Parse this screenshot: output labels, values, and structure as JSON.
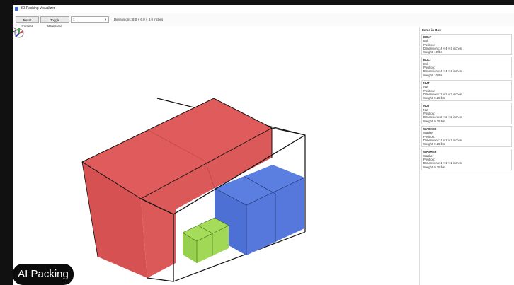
{
  "window": {
    "title": "3D Packing Visualizer"
  },
  "toolbar": {
    "reset_camera_label": "Reset Camera",
    "toggle_wireframe_label": "Toggle Wireframe",
    "combo_value": "1",
    "dimensions_text": "Dimensions: 8.0 × 6.0 × 4.0 inches"
  },
  "panel": {
    "header": "Items in Box",
    "items": [
      {
        "name": "BOLT",
        "type": "Bolt",
        "position": "Position:",
        "dimensions": "Dimensions: 4 × 4 × 4 inches",
        "weight": "Weight: 10 lbs"
      },
      {
        "name": "BOLT",
        "type": "Bolt",
        "position": "Position:",
        "dimensions": "Dimensions: 4 × 4 × 4 inches",
        "weight": "Weight: 10 lbs"
      },
      {
        "name": "NUT",
        "type": "Nut",
        "position": "Position:",
        "dimensions": "Dimensions: 2 × 2 × 2 inches",
        "weight": "Weight: 0.25 lbs"
      },
      {
        "name": "NUT",
        "type": "Nut",
        "position": "Position:",
        "dimensions": "Dimensions: 2 × 2 × 2 inches",
        "weight": "Weight: 0.25 lbs"
      },
      {
        "name": "WASHER",
        "type": "Washer",
        "position": "Position:",
        "dimensions": "Dimensions: 1 × 1 × 1 inches",
        "weight": "Weight: 0.25 lbs"
      },
      {
        "name": "WASHER",
        "type": "Washer",
        "position": "Position:",
        "dimensions": "Dimensions: 1 × 1 × 1 inches",
        "weight": "Weight: 0.25 lbs"
      }
    ]
  },
  "overlay": {
    "label": "AI Packing"
  },
  "colors": {
    "bolt": "#e05c5c",
    "nut": "#5a7fe0",
    "washer": "#a5dd5a",
    "outline": "#111111"
  }
}
